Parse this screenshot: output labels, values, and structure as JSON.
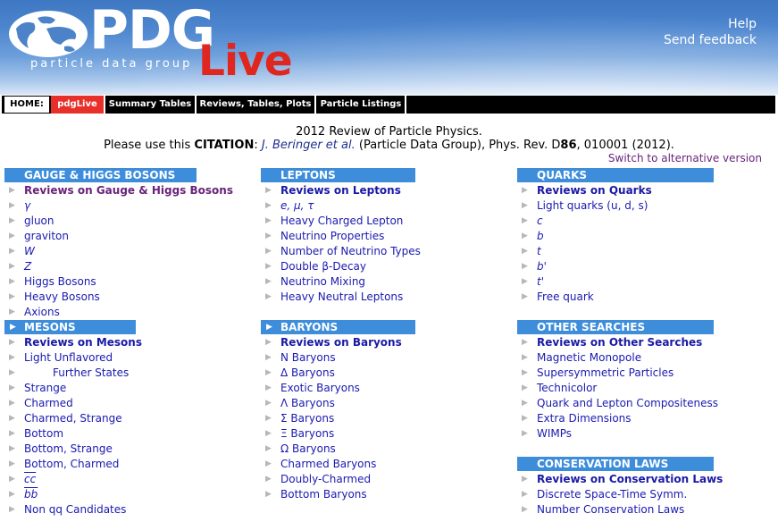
{
  "header": {
    "logo_main": "PDG",
    "logo_live": "Live",
    "logo_sub": "particle data group",
    "help": "Help",
    "feedback": "Send feedback"
  },
  "nav": [
    {
      "label": "HOME:"
    },
    {
      "label": "pdgLive"
    },
    {
      "label": "Summary Tables"
    },
    {
      "label": "Reviews, Tables, Plots"
    },
    {
      "label": "Particle Listings"
    }
  ],
  "citation": {
    "line1": "2012 Review of Particle Physics.",
    "prefix": "Please use this ",
    "citation_word": "CITATION",
    "colon": ": ",
    "authors": "J. Beringer et al.",
    "rest": " (Particle Data Group), Phys. Rev. D",
    "volume": "86",
    "tail": ", 010001 (2012)."
  },
  "switch_link": "Switch to alternative version",
  "colors": {
    "section_bg": "#3d8ddb",
    "link": "#1a1ab0",
    "visited": "#6a237b",
    "header_top": "#3f78c2",
    "live_red": "#e0271f"
  },
  "columns": [
    {
      "sections": [
        {
          "title": "GAUGE & HIGGS BOSONS",
          "items": [
            "Reviews on Gauge & Higgs Bosons",
            "γ",
            "gluon",
            "graviton",
            "W",
            "Z",
            "Higgs Bosons",
            "Heavy Bosons",
            "Axions"
          ]
        },
        {
          "title": "MESONS",
          "items": [
            "Reviews on Mesons",
            "Light Unflavored",
            "Further States",
            "Strange",
            "Charmed",
            "Charmed, Strange",
            "Bottom",
            "Bottom, Strange",
            "Bottom, Charmed",
            "cc",
            "bb",
            "Non qq Candidates"
          ]
        }
      ]
    },
    {
      "sections": [
        {
          "title": "LEPTONS",
          "items": [
            "Reviews on Leptons",
            "e, μ, τ",
            "Heavy Charged Lepton",
            "Neutrino Properties",
            "Number of Neutrino Types",
            "Double β-Decay",
            "Neutrino Mixing",
            "Heavy Neutral Leptons"
          ]
        },
        {
          "title": "BARYONS",
          "items": [
            "Reviews on Baryons",
            "N Baryons",
            "Δ Baryons",
            "Exotic Baryons",
            "Λ Baryons",
            "Σ Baryons",
            "Ξ Baryons",
            "Ω Baryons",
            "Charmed Baryons",
            "Doubly-Charmed",
            "Bottom Baryons"
          ]
        }
      ]
    },
    {
      "sections": [
        {
          "title": "QUARKS",
          "items": [
            "Reviews on Quarks",
            "Light quarks (u, d, s)",
            "c",
            "b",
            "t",
            "b'",
            "t'",
            "Free quark"
          ]
        },
        {
          "title": "OTHER SEARCHES",
          "items": [
            "Reviews on Other Searches",
            "Magnetic Monopole",
            "Supersymmetric Particles",
            "Technicolor",
            "Quark and Lepton Compositeness",
            "Extra Dimensions",
            "WIMPs"
          ]
        },
        {
          "title": "CONSERVATION LAWS",
          "items": [
            "Reviews on Conservation Laws",
            "Discrete Space-Time Symm.",
            "Number Conservation Laws"
          ]
        }
      ]
    }
  ],
  "icons": {
    "bullet": "triangle-right-icon",
    "logo": "globe-icon"
  }
}
